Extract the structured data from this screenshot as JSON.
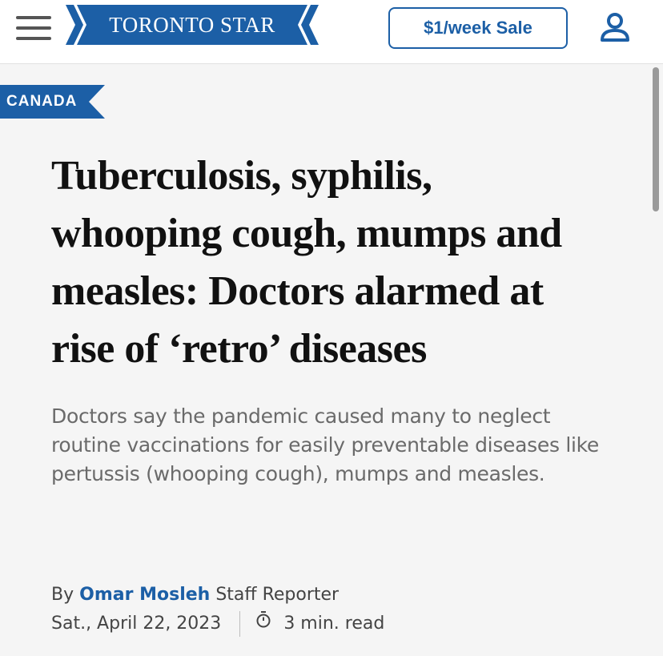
{
  "header": {
    "logo_text": "TORONTO STAR",
    "sale_label": "$1/week Sale",
    "icons": {
      "menu": "hamburger-menu-icon",
      "account": "user-account-icon"
    }
  },
  "article": {
    "category": "CANADA",
    "headline": "Tuberculosis, syphilis, whooping cough, mumps and measles: Doctors alarmed at rise of ‘retro’ diseases",
    "dek": "Doctors say the pandemic caused many to neglect routine vaccinations for easily preventable diseases like pertussis (whooping cough), mumps and measles.",
    "byline": {
      "prefix": "By",
      "author": "Omar Mosleh",
      "role": "Staff Reporter"
    },
    "date": "Sat., April 22, 2023",
    "read_time": "3 min. read"
  },
  "colors": {
    "brand_blue": "#1c5fa6",
    "background": "#f5f5f5",
    "headline": "#111111",
    "dek": "#6a6a6a"
  }
}
